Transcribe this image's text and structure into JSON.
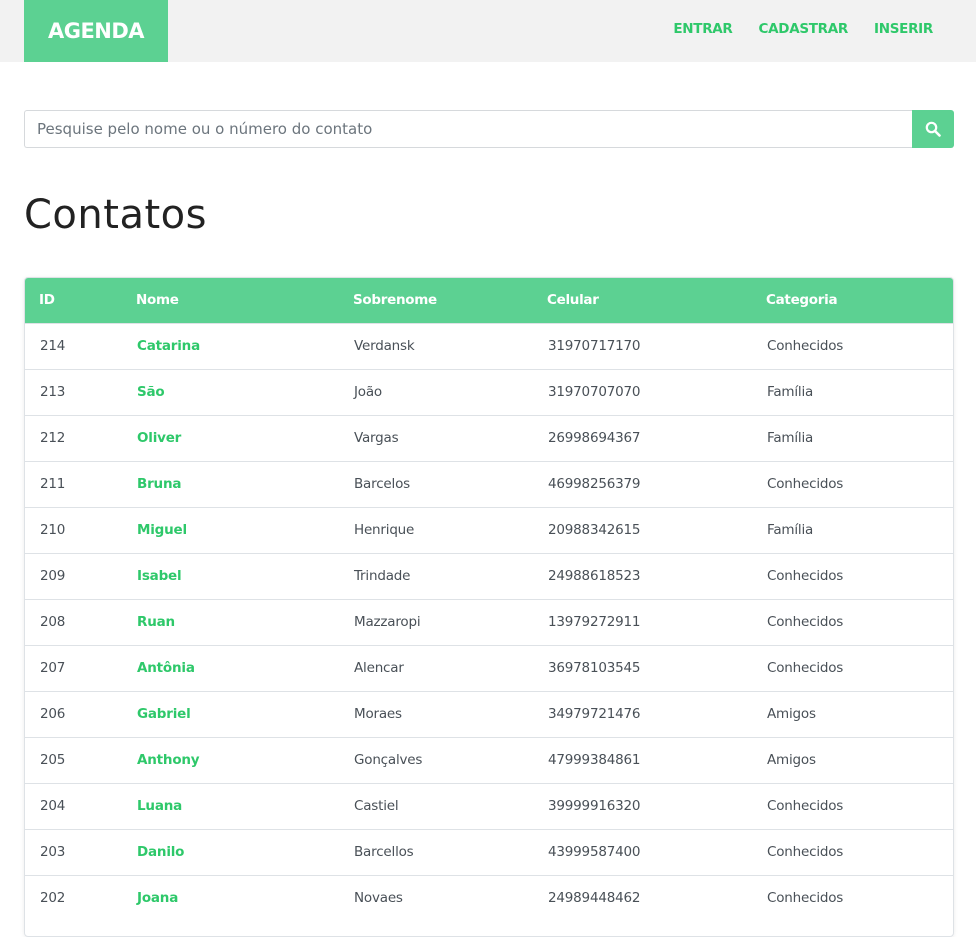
{
  "brand": {
    "label": "AGENDA"
  },
  "nav": {
    "items": [
      "ENTRAR",
      "CADASTRAR",
      "INSERIR"
    ]
  },
  "search": {
    "placeholder": "Pesquise pelo nome ou o número do contato",
    "value": "",
    "button_icon": "search-icon"
  },
  "page": {
    "title": "Contatos"
  },
  "table": {
    "headers": [
      "ID",
      "Nome",
      "Sobrenome",
      "Celular",
      "Categoria"
    ],
    "rows": [
      [
        "214",
        "Catarina",
        "Verdansk",
        "31970717170",
        "Conhecidos"
      ],
      [
        "213",
        "São",
        "João",
        "31970707070",
        "Família"
      ],
      [
        "212",
        "Oliver",
        "Vargas",
        "26998694367",
        "Família"
      ],
      [
        "211",
        "Bruna",
        "Barcelos",
        "46998256379",
        "Conhecidos"
      ],
      [
        "210",
        "Miguel",
        "Henrique",
        "20988342615",
        "Família"
      ],
      [
        "209",
        "Isabel",
        "Trindade",
        "24988618523",
        "Conhecidos"
      ],
      [
        "208",
        "Ruan",
        "Mazzaropi",
        "13979272911",
        "Conhecidos"
      ],
      [
        "207",
        "Antônia",
        "Alencar",
        "36978103545",
        "Conhecidos"
      ],
      [
        "206",
        "Gabriel",
        "Moraes",
        "34979721476",
        "Amigos"
      ],
      [
        "205",
        "Anthony",
        "Gonçalves",
        "47999384861",
        "Amigos"
      ],
      [
        "204",
        "Luana",
        "Castiel",
        "39999916320",
        "Conhecidos"
      ],
      [
        "203",
        "Danilo",
        "Barcellos",
        "43999587400",
        "Conhecidos"
      ],
      [
        "202",
        "Joana",
        "Novaes",
        "24989448462",
        "Conhecidos"
      ]
    ]
  },
  "colors": {
    "accent": "#5cd192",
    "link": "#2ec86a",
    "navbar_bg": "#f2f2f2"
  }
}
